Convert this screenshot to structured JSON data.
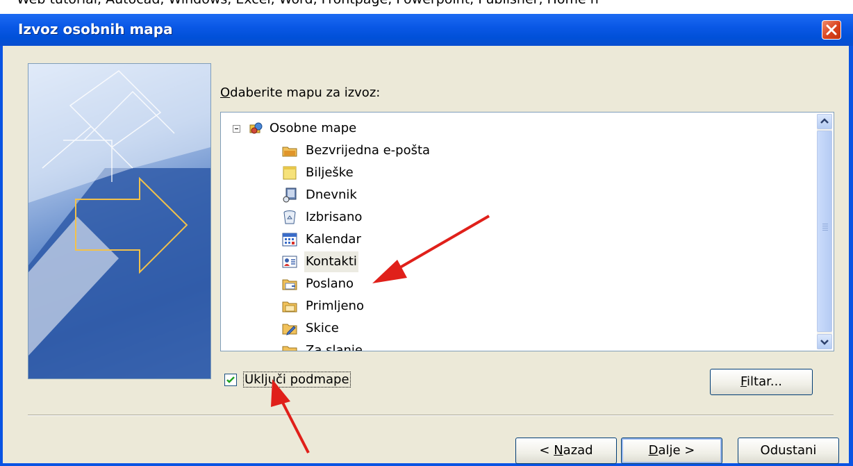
{
  "page_caption": "Web tutorial, Autocad, Windows, Excel, Word, Frontpage, Powerpoint, Publisher, Home n",
  "dialog": {
    "title": "Izvoz osobnih mapa",
    "folder_label_prefix": "",
    "folder_label_accel": "O",
    "folder_label_rest": "daberite mapu za izvoz:",
    "tree": {
      "root": "Osobne mape",
      "items": [
        {
          "label": "Bezvrijedna e-pošta",
          "icon": "junk-folder-icon"
        },
        {
          "label": "Bilješke",
          "icon": "notes-folder-icon"
        },
        {
          "label": "Dnevnik",
          "icon": "journal-folder-icon"
        },
        {
          "label": "Izbrisano",
          "icon": "deleted-items-icon"
        },
        {
          "label": "Kalendar",
          "icon": "calendar-folder-icon"
        },
        {
          "label": "Kontakti",
          "icon": "contacts-folder-icon",
          "selected": true
        },
        {
          "label": "Poslano",
          "icon": "sent-folder-icon"
        },
        {
          "label": "Primljeno",
          "icon": "inbox-folder-icon"
        },
        {
          "label": "Skice",
          "icon": "drafts-folder-icon"
        },
        {
          "label": "Za slanje",
          "icon": "outbox-folder-icon"
        }
      ]
    },
    "include_subfolders": {
      "checked": true,
      "label": "Uključi podmape"
    },
    "buttons": {
      "filter_accel": "F",
      "filter_rest": "iltar...",
      "back_prefix": "< ",
      "back_accel": "N",
      "back_rest": "azad",
      "next_accel": "D",
      "next_rest": "alje >",
      "cancel": "Odustani"
    }
  },
  "colors": {
    "titlebar": "#0a58e6",
    "dialog_bg": "#ece9d8",
    "arrow_annotation": "#e0201a"
  }
}
